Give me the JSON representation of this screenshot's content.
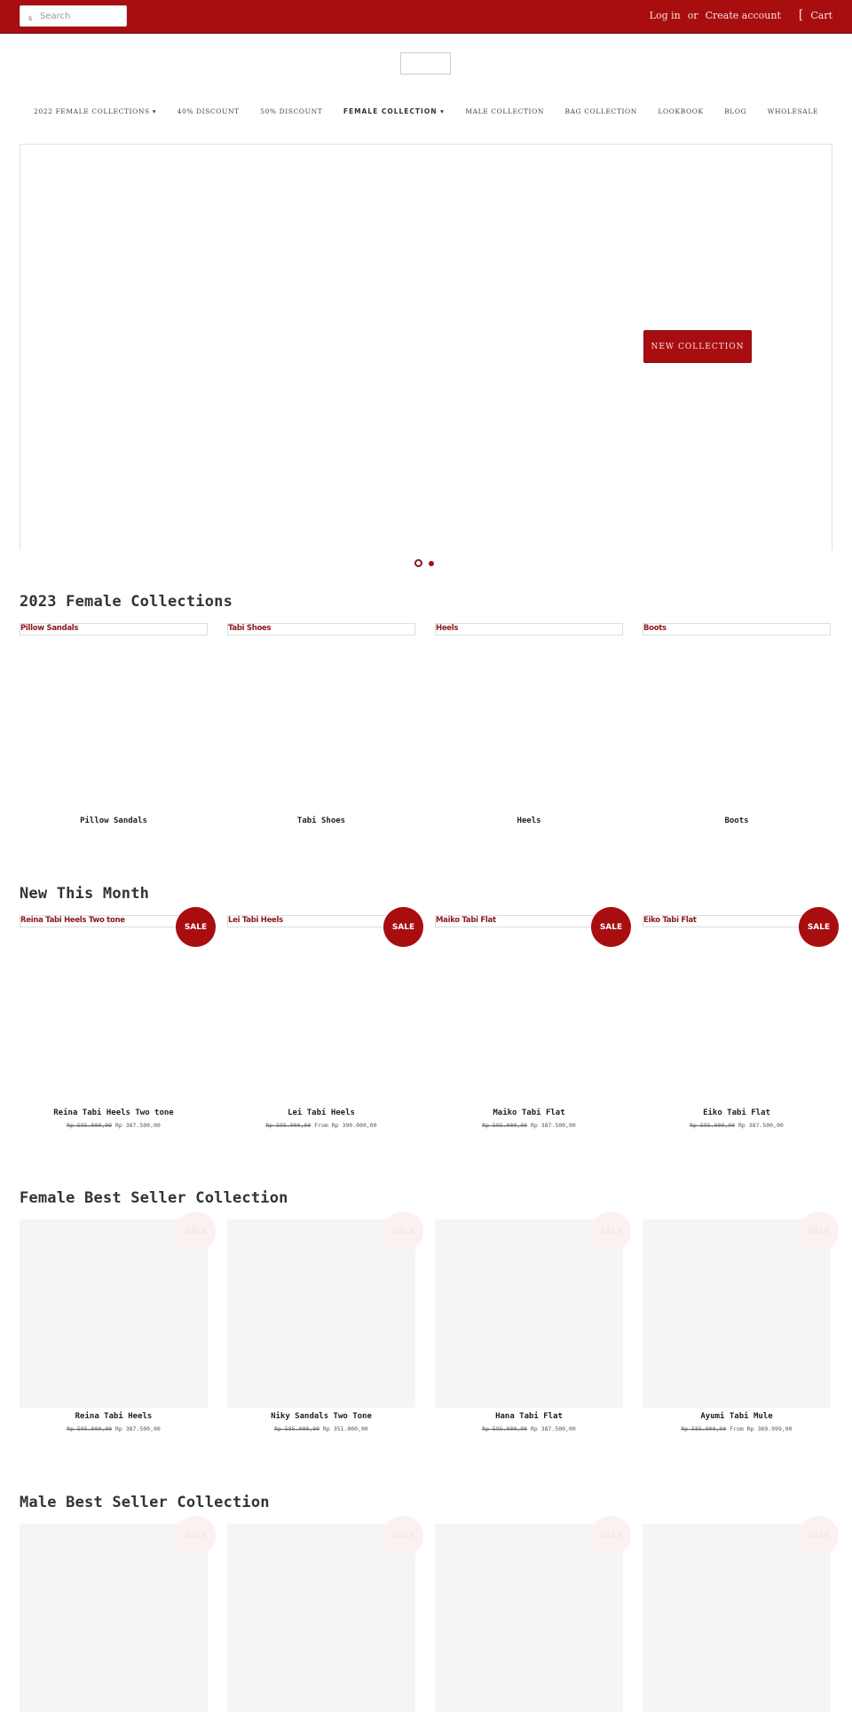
{
  "header": {
    "search_icon": "search-icon",
    "search_icon_glyph": "s",
    "search_placeholder": "Search",
    "login_label": "Log in",
    "or_label": "or",
    "create_account_label": "Create account",
    "cart_icon": "cart-icon",
    "cart_icon_glyph": "[",
    "cart_label": "Cart"
  },
  "colors": {
    "brand": "#a80e10",
    "link_title": "#8a1a1a",
    "placeholder_bg": "#f6f5f5"
  },
  "nav": {
    "items": [
      {
        "label": "2022 FEMALE COLLECTIONS ▾"
      },
      {
        "label": "40% DISCOUNT"
      },
      {
        "label": "50% DISCOUNT"
      },
      {
        "label": "FEMALE COLLECTION ▾"
      },
      {
        "label": "MALE COLLECTION"
      },
      {
        "label": "BAG COLLECTION"
      },
      {
        "label": "LOOKBOOK"
      },
      {
        "label": "BLOG"
      },
      {
        "label": "WHOLESALE"
      }
    ]
  },
  "hero": {
    "button_label": "NEW COLLECTION",
    "slides_count": 2,
    "active_slide": 1
  },
  "sections": {
    "female_collections": {
      "title": "2023 Female Collections",
      "items": [
        {
          "image_alt": "Pillow Sandals",
          "name": "Pillow Sandals"
        },
        {
          "image_alt": "Tabi Shoes",
          "name": "Tabi Shoes"
        },
        {
          "image_alt": "Heels",
          "name": "Heels"
        },
        {
          "image_alt": "Boots",
          "name": "Boots"
        }
      ]
    },
    "new_this_month": {
      "title": "New This Month",
      "sale_label": "SALE",
      "items": [
        {
          "image_alt": "Reina Tabi Heels Two tone",
          "name": "Reina Tabi Heels Two tone",
          "old_price": "Rp 595.000,00",
          "price": "Rp 387.500,00"
        },
        {
          "image_alt": "Lei Tabi Heels",
          "name": "Lei Tabi Heels",
          "old_price": "Rp 595.000,00",
          "price": "From Rp 390.000,00"
        },
        {
          "image_alt": "Maiko Tabi Flat",
          "name": "Maiko Tabi Flat",
          "old_price": "Rp 595.000,00",
          "price": "Rp 387.500,00"
        },
        {
          "image_alt": "Eiko Tabi Flat",
          "name": "Eiko Tabi Flat",
          "old_price": "Rp 595.000,00",
          "price": "Rp 387.500,00"
        }
      ]
    },
    "female_best_seller": {
      "title": "Female Best Seller Collection",
      "sale_label": "SALE",
      "items": [
        {
          "name": "Reina Tabi Heels",
          "old_price": "Rp 595.000,00",
          "price": "Rp 387.500,00"
        },
        {
          "name": "Niky Sandals Two Tone",
          "old_price": "Rp 585.000,00",
          "price": "Rp 351.000,00"
        },
        {
          "name": "Hana Tabi Flat",
          "old_price": "Rp 595.000,00",
          "price": "Rp 387.500,00"
        },
        {
          "name": "Ayumi Tabi Mule",
          "old_price": "Rp 585.000,00",
          "price": "From Rp 369.999,00"
        }
      ]
    },
    "male_best_seller": {
      "title": "Male Best Seller Collection",
      "sale_label": "SALE"
    }
  }
}
